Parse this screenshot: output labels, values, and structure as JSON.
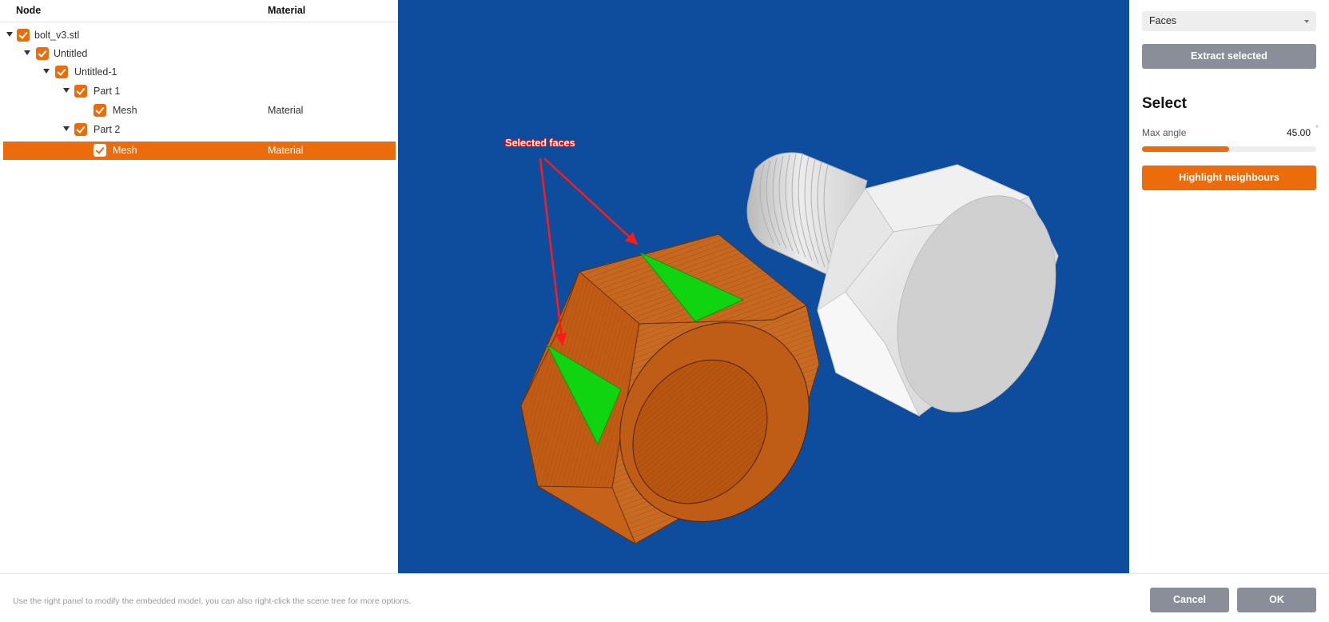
{
  "tree": {
    "header_node": "Node",
    "header_material": "Material",
    "rows": [
      {
        "label": "bolt_v3.stl",
        "material": "",
        "expanded": true
      },
      {
        "label": "Untitled",
        "material": "",
        "expanded": true
      },
      {
        "label": "Untitled-1",
        "material": "",
        "expanded": true
      },
      {
        "label": "Part 1",
        "material": "",
        "expanded": true
      },
      {
        "label": "Mesh",
        "material": "Material"
      },
      {
        "label": "Part 2",
        "material": "",
        "expanded": true
      },
      {
        "label": "Mesh",
        "material": "Material",
        "selected": true
      }
    ]
  },
  "viewport": {
    "annotation": "Selected faces",
    "background_color": "#0e4d9e",
    "nut_color": "#c7621a",
    "selected_face_color": "#0fd40f",
    "bolt_color": "#e2e2e2"
  },
  "side_panel": {
    "mode_select": {
      "value": "Faces"
    },
    "extract_label": "Extract selected",
    "section_title": "Select",
    "max_angle_label": "Max angle",
    "max_angle_value": "45.00",
    "max_angle_unit": "°",
    "max_angle_fraction": 0.5,
    "highlight_label": "Highlight neighbours"
  },
  "footer": {
    "hint": "Use the right panel to modify the embedded model, you can also right-click the scene tree for more options.",
    "cancel_label": "Cancel",
    "ok_label": "OK"
  },
  "colors": {
    "accent": "#ec6c0b",
    "button_grey": "#8a8e99"
  }
}
